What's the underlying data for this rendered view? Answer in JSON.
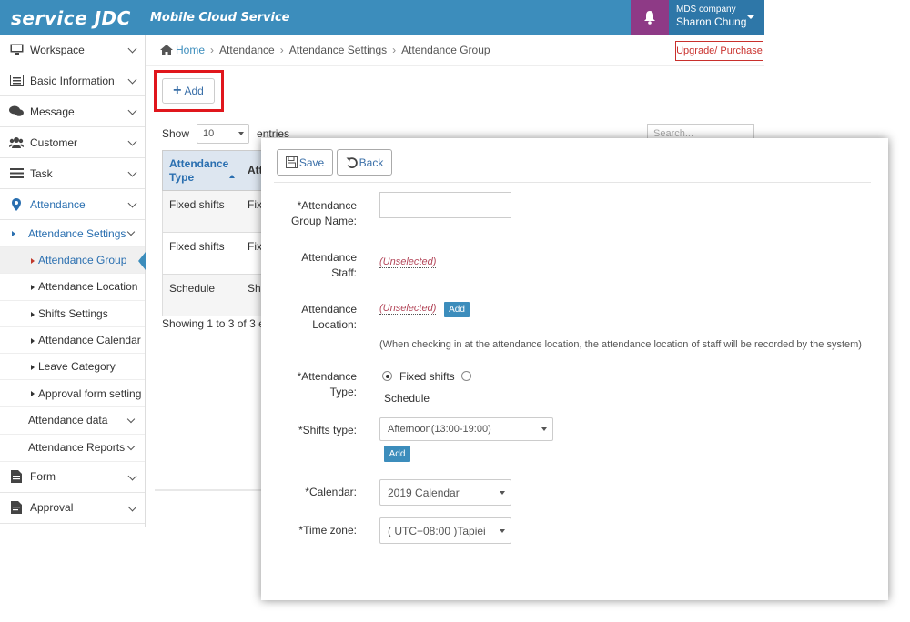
{
  "header": {
    "brand": "service JDC",
    "subtitle": "Mobile Cloud Service",
    "company": "MDS company",
    "user": "Sharon Chung"
  },
  "sidebar": {
    "items": [
      {
        "label": "Workspace",
        "icon": "monitor-icon"
      },
      {
        "label": "Basic Information",
        "icon": "list-icon"
      },
      {
        "label": "Message",
        "icon": "chat-icon"
      },
      {
        "label": "Customer",
        "icon": "users-icon"
      },
      {
        "label": "Task",
        "icon": "task-icon"
      },
      {
        "label": "Attendance",
        "icon": "location-pin-icon"
      }
    ],
    "attendance_settings": "Attendance Settings",
    "settings_children": [
      "Attendance Group",
      "Attendance Location",
      "Shifts Settings",
      "Attendance Calendar",
      "Leave Category",
      "Approval form setting"
    ],
    "attendance_data": "Attendance data",
    "attendance_reports": "Attendance Reports",
    "form": "Form",
    "approval": "Approval"
  },
  "breadcrumb": {
    "home": "Home",
    "items": [
      "Attendance",
      "Attendance Settings",
      "Attendance Group"
    ]
  },
  "upgrade_label": "Upgrade/ Purchase",
  "add_label": "Add",
  "list": {
    "show": "Show",
    "entries_value": "10",
    "entries": "entries",
    "search_placeholder": "Search...",
    "header_col1": "Attendance Type",
    "header_col2": "Att",
    "rows": [
      {
        "c1": "Fixed shifts",
        "c2": "Fix"
      },
      {
        "c1": "Fixed shifts",
        "c2": "Fix"
      },
      {
        "c1": "Schedule",
        "c2": "Shi"
      }
    ],
    "showing": "Showing 1 to 3 of 3 e"
  },
  "modal": {
    "save": "Save",
    "back": "Back",
    "group_name_label": "*Attendance Group Name:",
    "staff_label": "Attendance Staff:",
    "staff_value": "(Unselected)",
    "location_label": "Attendance Location:",
    "location_value": "(Unselected)",
    "location_add": "Add",
    "location_note": "(When checking in at the attendance location, the attendance location of staff will be recorded by the system)",
    "type_label": "*Attendance Type:",
    "type_fixed": "Fixed shifts",
    "type_schedule": "Schedule",
    "shifts_label": "*Shifts type:",
    "shifts_value": "Afternoon(13:00-19:00)",
    "shifts_add": "Add",
    "calendar_label": "*Calendar:",
    "calendar_value": "2019 Calendar",
    "timezone_label": "*Time zone:",
    "timezone_value": "( UTC+08:00 )Tapiei"
  },
  "colors": {
    "topbar": "#3c8dbc",
    "bell": "#8e3a86",
    "highlight": "#e0161c",
    "accent": "#2a6fb0"
  }
}
